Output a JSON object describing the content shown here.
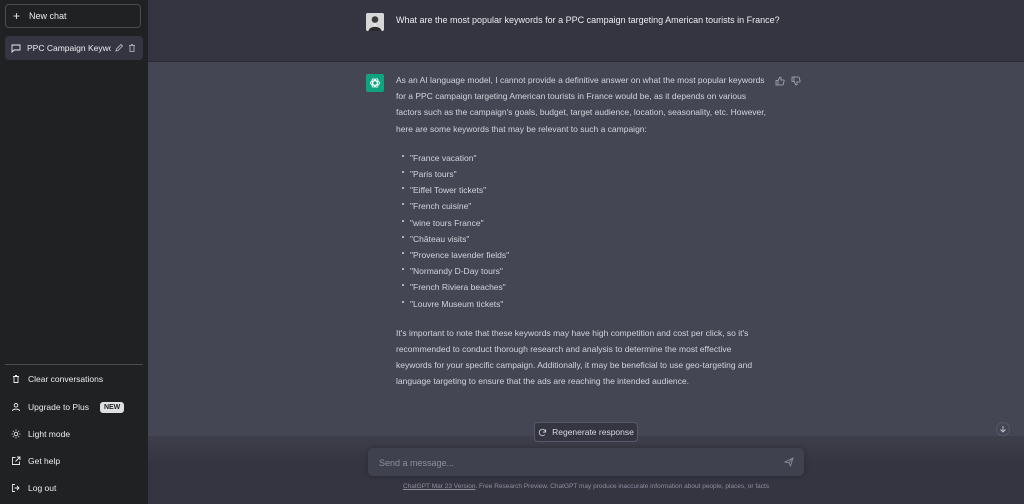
{
  "sidebar": {
    "new_chat_label": "New chat",
    "conversations": [
      {
        "title": "PPC Campaign Keywor"
      }
    ],
    "actions": {
      "clear": "Clear conversations",
      "upgrade": "Upgrade to Plus",
      "upgrade_badge": "NEW",
      "light_mode": "Light mode",
      "get_help": "Get help",
      "log_out": "Log out"
    }
  },
  "conversation": {
    "user_message": "What are the most popular keywords for a PPC campaign targeting American tourists in France?",
    "assistant": {
      "intro": "As an AI language model, I cannot provide a definitive answer on what the most popular keywords for a PPC campaign targeting American tourists in France would be, as it depends on various factors such as the campaign's goals, budget, target audience, location, seasonality, etc. However, here are some keywords that may be relevant to such a campaign:",
      "keywords": [
        "\"France vacation\"",
        "\"Paris tours\"",
        "\"Eiffel Tower tickets\"",
        "\"French cuisine\"",
        "\"wine tours France\"",
        "\"Château visits\"",
        "\"Provence lavender fields\"",
        "\"Normandy D-Day tours\"",
        "\"French Riviera beaches\"",
        "\"Louvre Museum tickets\""
      ],
      "outro": "It's important to note that these keywords may have high competition and cost per click, so it's recommended to conduct thorough research and analysis to determine the most effective keywords for your specific campaign. Additionally, it may be beneficial to use geo-targeting and language targeting to ensure that the ads are reaching the intended audience."
    }
  },
  "composer": {
    "regenerate_label": "Regenerate response",
    "placeholder": "Send a message...",
    "footer_link": "ChatGPT Mar 23 Version",
    "footer_text": ". Free Research Preview. ChatGPT may produce inaccurate information about people, places, or facts"
  },
  "colors": {
    "sidebar_bg": "#202123",
    "main_bg": "#343541",
    "assistant_bg": "#444654",
    "brand_green": "#10a37f"
  },
  "icons": {
    "new_chat": "plus-icon",
    "conversation": "chat-bubble-icon",
    "edit": "pencil-icon",
    "delete": "trash-icon",
    "clear": "trash-icon",
    "upgrade": "user-icon",
    "light_mode": "sun-icon",
    "help": "external-link-icon",
    "logout": "logout-icon",
    "thumbs_up": "thumbs-up-icon",
    "thumbs_down": "thumbs-down-icon",
    "regenerate": "refresh-icon",
    "send": "send-icon",
    "scroll_down": "arrow-down-icon"
  }
}
